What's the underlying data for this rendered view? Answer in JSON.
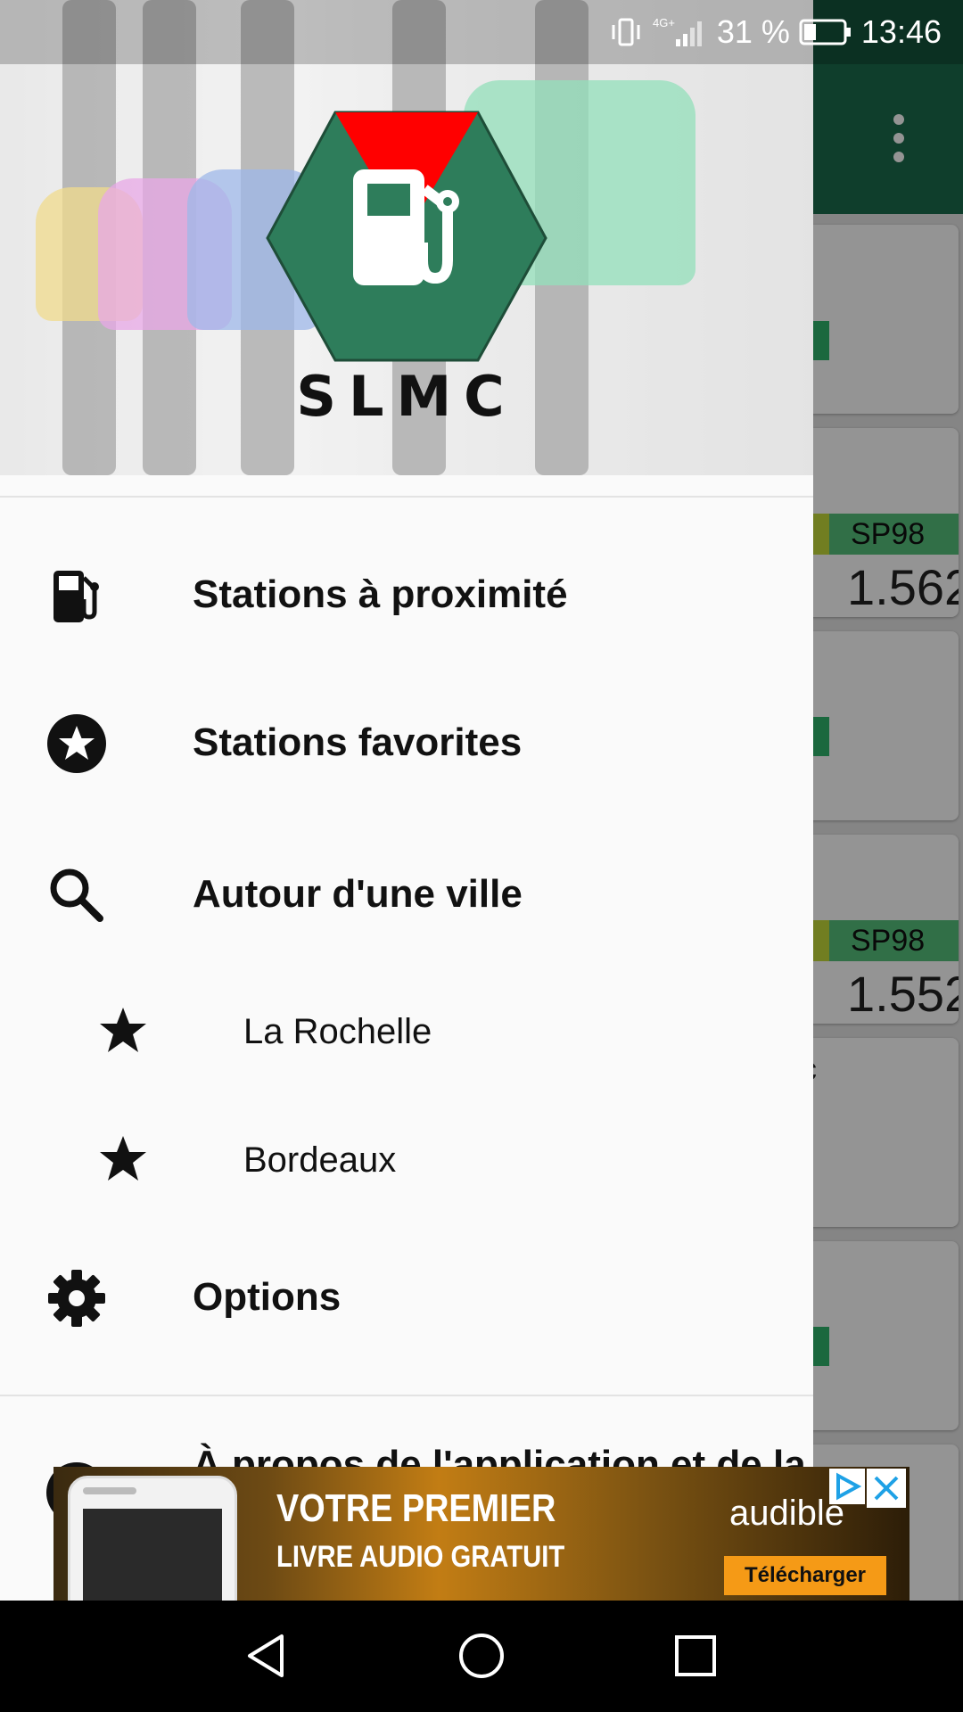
{
  "status_bar": {
    "network": "4G+",
    "battery_percent": "31 %",
    "battery_level": 0.31,
    "time": "13:46"
  },
  "background_app": {
    "toolbar_color": "#1b6b4c",
    "cards": [
      {
        "fuel_label": "",
        "price": ""
      },
      {
        "fuel_label": "SP98",
        "price": "1.562"
      },
      {
        "fuel_label": "",
        "price": ""
      },
      {
        "fuel_label": "SP98",
        "price": "1.552"
      },
      {
        "fuel_label": "",
        "price": "",
        "letter": "c"
      },
      {
        "fuel_label": "",
        "price": ""
      }
    ]
  },
  "drawer": {
    "logo_text": "SLMC",
    "logo_colors": {
      "hexagon": "#2e7d5b",
      "accent": "#ff0000",
      "pump": "#ffffff"
    },
    "items": [
      {
        "label": "Stations à proximité",
        "icon": "fuel-pump-icon"
      },
      {
        "label": "Stations favorites",
        "icon": "star-circle-icon"
      },
      {
        "label": "Autour d'une ville",
        "icon": "search-icon"
      }
    ],
    "saved_cities": [
      {
        "label": "La Rochelle",
        "icon": "star-icon"
      },
      {
        "label": "Bordeaux",
        "icon": "star-icon"
      }
    ],
    "options": {
      "label": "Options",
      "icon": "gear-icon"
    },
    "about": {
      "label": "À propos de l'application et de la"
    }
  },
  "ad": {
    "line1": "VOTRE PREMIER",
    "line2": "LIVRE AUDIO GRATUIT",
    "brand": "audible",
    "cta": "Télécharger"
  },
  "nav": {
    "back": "back-icon",
    "home": "home-icon",
    "recents": "recents-icon"
  }
}
